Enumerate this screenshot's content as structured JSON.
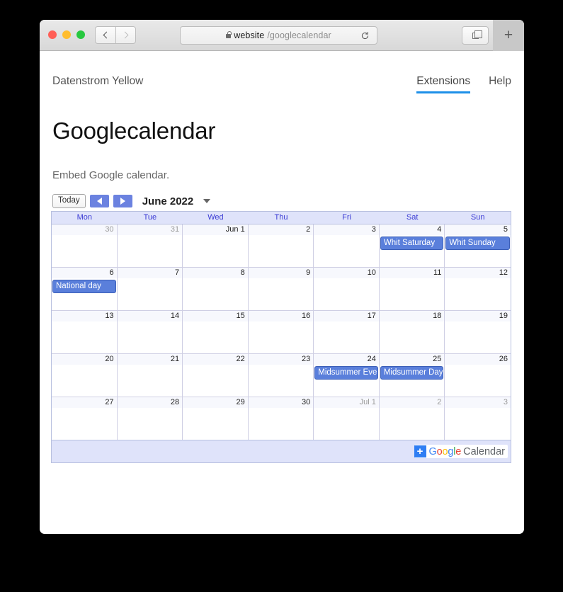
{
  "browser": {
    "url_host": "website",
    "url_path": "/googlecalendar",
    "back_icon": "chevron-left-icon",
    "forward_icon": "chevron-right-icon",
    "reload_icon": "reload-icon",
    "lock_icon": "lock-icon",
    "tabs_icon": "show-all-tabs-icon",
    "new_tab_label": "+"
  },
  "site": {
    "name": "Datenstrom Yellow",
    "nav": [
      {
        "label": "Extensions",
        "active": true
      },
      {
        "label": "Help",
        "active": false
      }
    ]
  },
  "page": {
    "title": "Googlecalendar",
    "description": "Embed Google calendar."
  },
  "calendar": {
    "today_label": "Today",
    "prev_label": "prev-month-arrow",
    "next_label": "next-month-arrow",
    "month_title": "June 2022",
    "view_caret": "chevron-down-icon",
    "day_headers": [
      "Mon",
      "Tue",
      "Wed",
      "Thu",
      "Fri",
      "Sat",
      "Sun"
    ],
    "weeks": [
      [
        {
          "date": "30",
          "other": true,
          "event": null
        },
        {
          "date": "31",
          "other": true,
          "event": null
        },
        {
          "date": "Jun 1",
          "other": false,
          "event": null
        },
        {
          "date": "2",
          "other": false,
          "event": null
        },
        {
          "date": "3",
          "other": false,
          "event": null
        },
        {
          "date": "4",
          "other": false,
          "event": "Whit Saturday"
        },
        {
          "date": "5",
          "other": false,
          "event": "Whit Sunday"
        }
      ],
      [
        {
          "date": "6",
          "other": false,
          "event": "National day"
        },
        {
          "date": "7",
          "other": false,
          "event": null
        },
        {
          "date": "8",
          "other": false,
          "event": null
        },
        {
          "date": "9",
          "other": false,
          "event": null
        },
        {
          "date": "10",
          "other": false,
          "event": null
        },
        {
          "date": "11",
          "other": false,
          "event": null
        },
        {
          "date": "12",
          "other": false,
          "event": null
        }
      ],
      [
        {
          "date": "13",
          "other": false,
          "event": null
        },
        {
          "date": "14",
          "other": false,
          "event": null
        },
        {
          "date": "15",
          "other": false,
          "event": null
        },
        {
          "date": "16",
          "other": false,
          "event": null
        },
        {
          "date": "17",
          "other": false,
          "event": null
        },
        {
          "date": "18",
          "other": false,
          "event": null
        },
        {
          "date": "19",
          "other": false,
          "event": null
        }
      ],
      [
        {
          "date": "20",
          "other": false,
          "event": null
        },
        {
          "date": "21",
          "other": false,
          "event": null
        },
        {
          "date": "22",
          "other": false,
          "event": null
        },
        {
          "date": "23",
          "other": false,
          "event": null
        },
        {
          "date": "24",
          "other": false,
          "event": "Midsummer Eve"
        },
        {
          "date": "25",
          "other": false,
          "event": "Midsummer Day"
        },
        {
          "date": "26",
          "other": false,
          "event": null
        }
      ],
      [
        {
          "date": "27",
          "other": false,
          "event": null
        },
        {
          "date": "28",
          "other": false,
          "event": null
        },
        {
          "date": "29",
          "other": false,
          "event": null
        },
        {
          "date": "30",
          "other": false,
          "event": null
        },
        {
          "date": "Jul 1",
          "other": true,
          "event": null
        },
        {
          "date": "2",
          "other": true,
          "event": null
        },
        {
          "date": "3",
          "other": true,
          "event": null
        }
      ]
    ],
    "footer": {
      "add_label": "+",
      "brand_letters": [
        {
          "ch": "G",
          "color": "#4285f4"
        },
        {
          "ch": "o",
          "color": "#ea4335"
        },
        {
          "ch": "o",
          "color": "#fbbc05"
        },
        {
          "ch": "g",
          "color": "#4285f4"
        },
        {
          "ch": "l",
          "color": "#34a853"
        },
        {
          "ch": "e",
          "color": "#ea4335"
        }
      ],
      "product": "Calendar"
    }
  },
  "colors": {
    "accent": "#1e90e8",
    "event_blue": "#5a7fdb",
    "header_lavender": "#dfe3fa",
    "gcal_button_blue": "#6b82e0"
  }
}
